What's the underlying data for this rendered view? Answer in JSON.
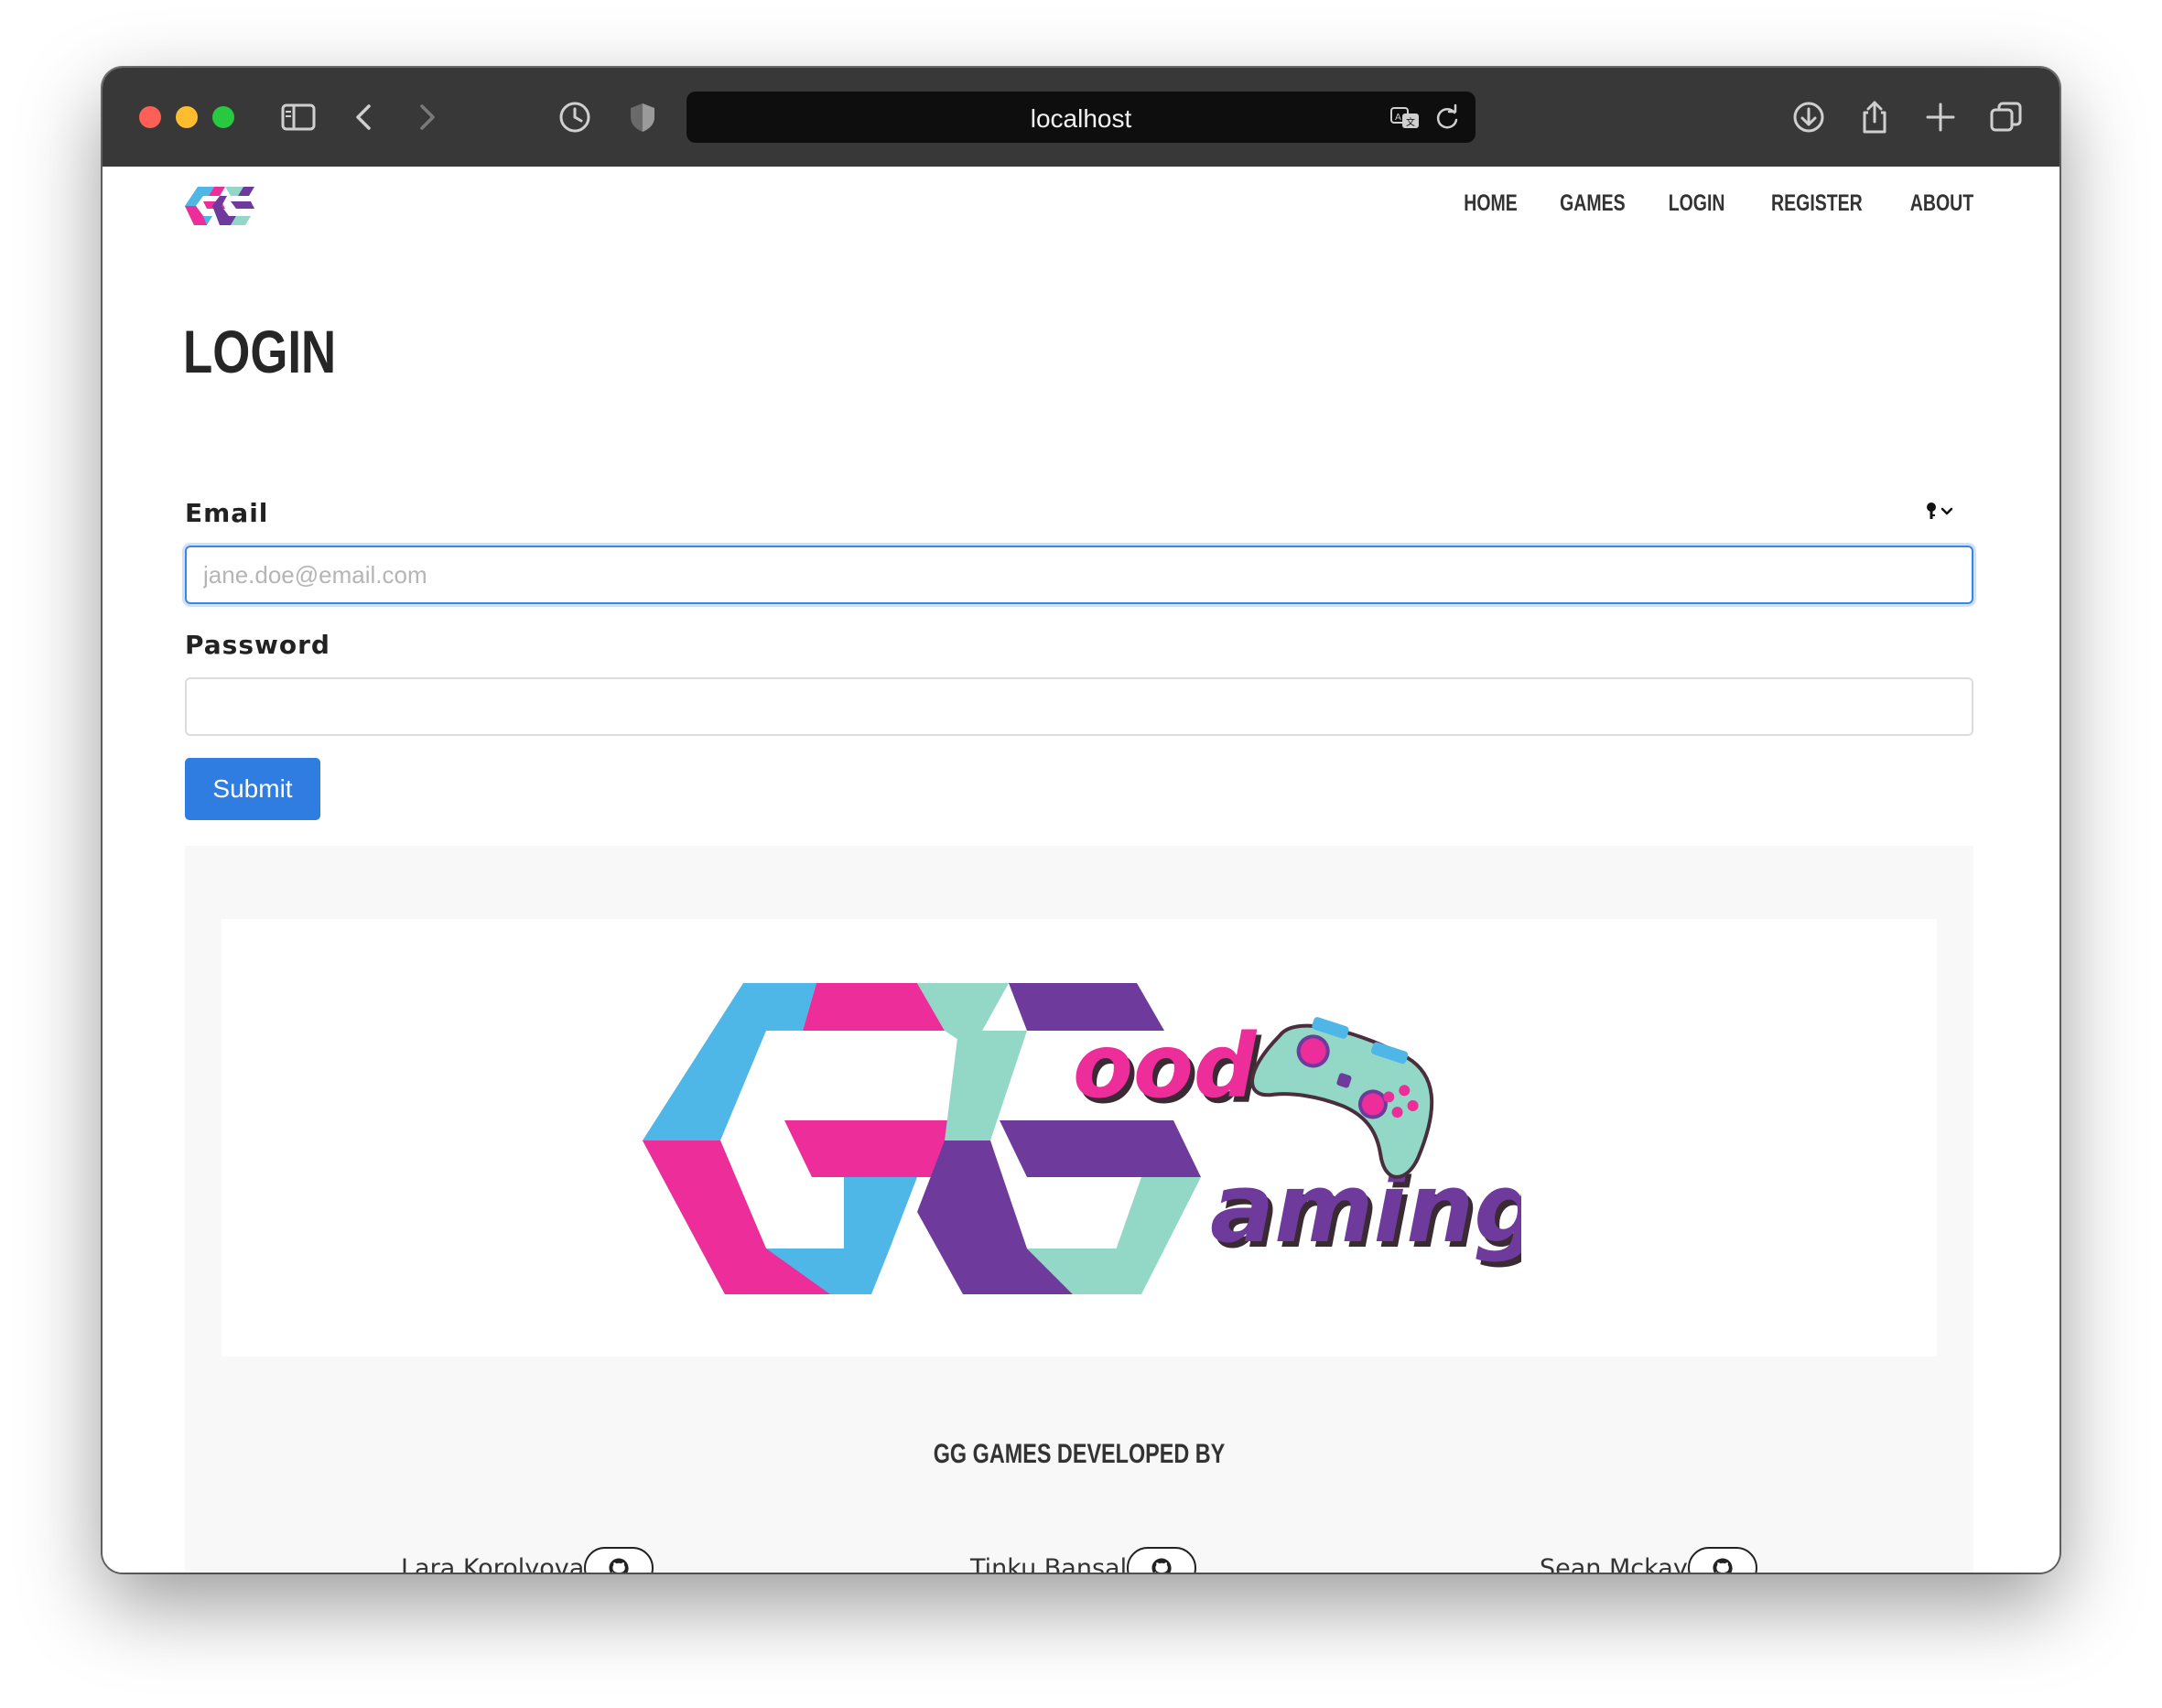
{
  "browser": {
    "url": "localhost",
    "toolbar_icons": [
      "sidebar-icon",
      "back-icon",
      "forward-icon",
      "history-icon",
      "shield-icon",
      "translate-icon",
      "reload-icon",
      "download-icon",
      "share-icon",
      "new-tab-icon",
      "tabs-overview-icon"
    ]
  },
  "nav": {
    "items": [
      "HOME",
      "GAMES",
      "LOGIN",
      "REGISTER",
      "ABOUT"
    ]
  },
  "page": {
    "title": "LOGIN"
  },
  "form": {
    "email_label": "Email",
    "email_placeholder": "jane.doe@email.com",
    "email_value": "",
    "password_label": "Password",
    "password_value": "",
    "submit_label": "Submit"
  },
  "footer": {
    "heading": "GG GAMES DEVELOPED BY",
    "developers": [
      {
        "name": "Lara Korolyova",
        "icon": "github-icon"
      },
      {
        "name": "Tinku Bansal",
        "icon": "github-icon"
      },
      {
        "name": "Sean Mckay",
        "icon": "github-icon"
      }
    ]
  },
  "colors": {
    "accent_blue": "#2f7de0",
    "brand_cyan": "#4fb6e8",
    "brand_pink": "#ec2d9a",
    "brand_purple": "#6e3a9c",
    "brand_mint": "#93d8c6"
  }
}
